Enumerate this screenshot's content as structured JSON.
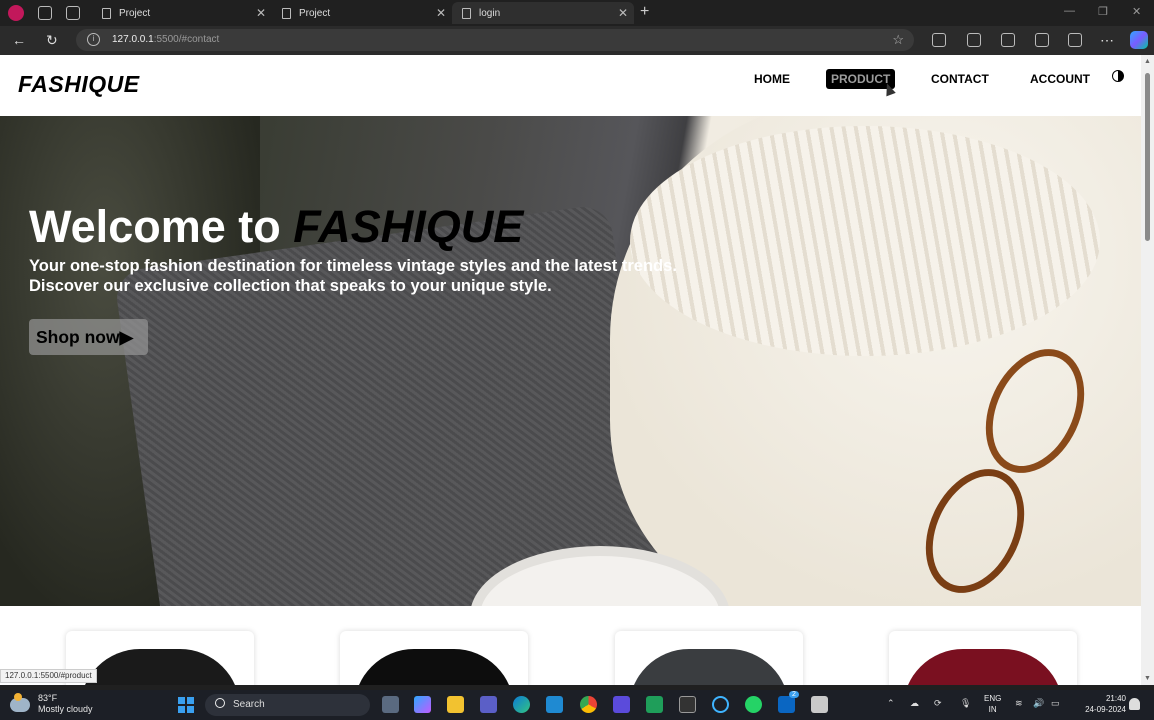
{
  "browser": {
    "tabs": [
      {
        "title": "Project",
        "active": false
      },
      {
        "title": "Project",
        "active": false
      },
      {
        "title": "login",
        "active": true
      }
    ],
    "url_host": "127.0.0.1",
    "url_path": ":5500/#contact",
    "status_url": "127.0.0.1:5500/#product"
  },
  "site": {
    "logo": "FASHIQUE",
    "nav": [
      "HOME",
      "PRODUCT",
      "CONTACT",
      "ACCOUNT"
    ],
    "hovered_nav": "PRODUCT"
  },
  "hero": {
    "title_prefix": "Welcome to ",
    "title_brand": "FASHIQUE",
    "subtitle_line1": "Your one-stop fashion destination for timeless vintage styles and the latest trends.",
    "subtitle_line2": "Discover our exclusive collection that speaks to your unique style.",
    "cta": "Shop now",
    "cta_arrow": "▶"
  },
  "products": {
    "colors": [
      "#1a1a1a",
      "#0d0d0d",
      "#3a3d40",
      "#7a1020"
    ]
  },
  "taskbar": {
    "weather_temp": "83°F",
    "weather_desc": "Mostly cloudy",
    "search_label": "Search",
    "lang_line1": "ENG",
    "lang_line2": "IN",
    "time": "21:40",
    "date": "24-09-2024",
    "badge": "2"
  }
}
